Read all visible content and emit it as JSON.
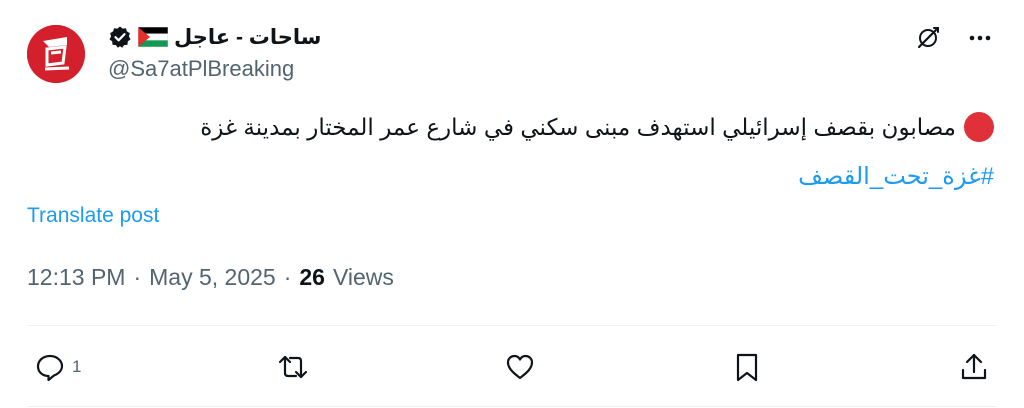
{
  "author": {
    "name": "ساحات - عاجل",
    "handle": "@Sa7atPlBreaking",
    "avatar_color": "#d3202c"
  },
  "tweet": {
    "text": "مصابون بقصف إسرائيلي استهدف مبنى سكني في شارع عمر المختار بمدينة غزة",
    "hashtag": "#غزة_تحت_القصف",
    "translate_label": "Translate post",
    "time": "12:13 PM",
    "separator": "·",
    "date": "May 5, 2025",
    "views_count": "26",
    "views_label": "Views"
  },
  "actions": {
    "reply_count": "1"
  },
  "colors": {
    "accent": "#1d9bf0",
    "muted": "#536471",
    "dot": "#e0303a"
  }
}
